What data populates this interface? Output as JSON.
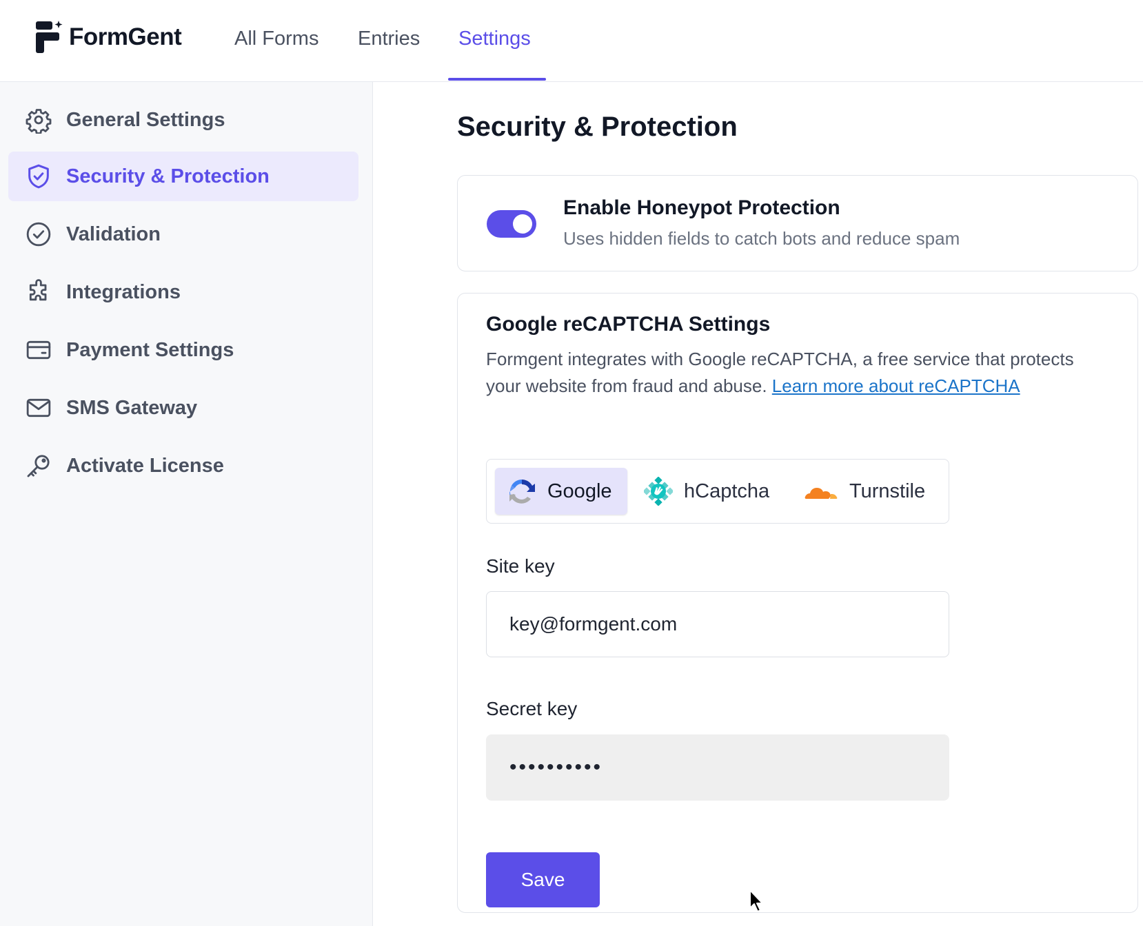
{
  "app": {
    "name": "FormGent",
    "accent_color": "#5b4ee8"
  },
  "nav": {
    "items": [
      {
        "label": "All Forms",
        "active": false
      },
      {
        "label": "Entries",
        "active": false
      },
      {
        "label": "Settings",
        "active": true
      }
    ]
  },
  "sidebar": {
    "items": [
      {
        "label": "General Settings",
        "icon": "gear-icon",
        "active": false
      },
      {
        "label": "Security & Protection",
        "icon": "shield-check-icon",
        "active": true
      },
      {
        "label": "Validation",
        "icon": "check-circle-icon",
        "active": false
      },
      {
        "label": "Integrations",
        "icon": "puzzle-icon",
        "active": false
      },
      {
        "label": "Payment Settings",
        "icon": "credit-card-icon",
        "active": false
      },
      {
        "label": "SMS Gateway",
        "icon": "envelope-icon",
        "active": false
      },
      {
        "label": "Activate License",
        "icon": "key-icon",
        "active": false
      }
    ]
  },
  "main": {
    "title": "Security & Protection",
    "honeypot": {
      "title": "Enable Honeypot Protection",
      "description": "Uses hidden fields to catch bots and reduce spam",
      "enabled": true
    },
    "recaptcha": {
      "title": "Google reCAPTCHA Settings",
      "description": "Formgent integrates with Google reCAPTCHA, a free service that protects your website from fraud and abuse.",
      "link_text": "Learn more about reCAPTCHA",
      "providers": [
        {
          "label": "Google",
          "icon": "recaptcha-icon",
          "active": true
        },
        {
          "label": "hCaptcha",
          "icon": "hcaptcha-icon",
          "active": false
        },
        {
          "label": "Turnstile",
          "icon": "cloudflare-icon",
          "active": false
        }
      ],
      "site_key_label": "Site key",
      "site_key_value": "key@formgent.com",
      "secret_key_label": "Secret key",
      "secret_key_value": "••••••••••",
      "save_label": "Save"
    }
  }
}
